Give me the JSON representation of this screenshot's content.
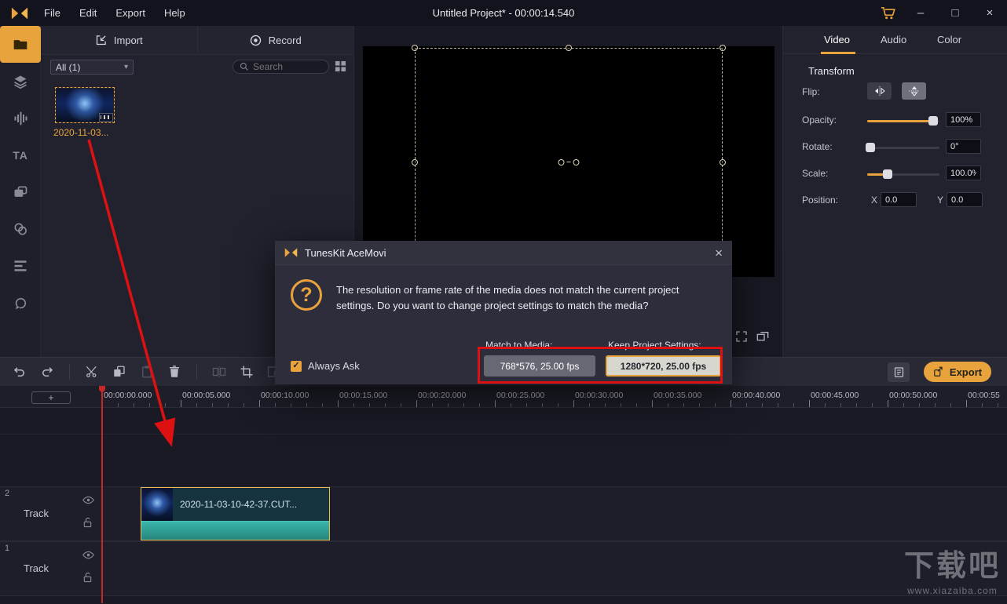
{
  "titlebar": {
    "menus": [
      "File",
      "Edit",
      "Export",
      "Help"
    ],
    "title": "Untitled Project* - 00:00:14.540"
  },
  "icons": {
    "plus": "+",
    "close": "×",
    "minimize": "–",
    "maximize": "□",
    "chevron_down": "▾",
    "check": "✓",
    "question": "?",
    "text_tool": "TA"
  },
  "media_panel": {
    "import_tab": "Import",
    "record_tab": "Record",
    "filter_value": "All (1)",
    "search_placeholder": "Search",
    "item_label": "2020-11-03..."
  },
  "inspector": {
    "tabs": [
      "Video",
      "Audio",
      "Color"
    ],
    "transform": {
      "heading": "Transform",
      "flip_label": "Flip:",
      "opacity_label": "Opacity:",
      "opacity_value": "100%",
      "rotate_label": "Rotate:",
      "rotate_value": "0°",
      "scale_label": "Scale:",
      "scale_value": "100.0%",
      "position_label": "Position:",
      "x_label": "X",
      "x_value": "0.0",
      "y_label": "Y",
      "y_value": "0.0"
    }
  },
  "toolbar": {
    "export_label": "Export"
  },
  "dialog": {
    "title": "TunesKit AceMovi",
    "message": "The resolution or frame rate of the media does not match the current project settings. Do you want to change project settings to match the media?",
    "always_ask_label": "Always Ask",
    "match_label": "Match to Media:",
    "keep_label": "Keep Project Settings:",
    "match_button": "768*576, 25.00 fps",
    "keep_button": "1280*720, 25.00 fps"
  },
  "timeline": {
    "ruler_labels": [
      "00:00:00.000",
      "00:00:05.000",
      "00:00:10.000",
      "00:00:15.000",
      "00:00:20.000",
      "00:00:25.000",
      "00:00:30.000",
      "00:00:35.000",
      "00:00:40.000",
      "00:00:45.000",
      "00:00:50.000",
      "00:00:55"
    ],
    "tracks": [
      {
        "number": "2",
        "label": "Track"
      },
      {
        "number": "1",
        "label": "Track"
      }
    ],
    "clip_label": "2020-11-03-10-42-37.CUT..."
  },
  "watermark": {
    "line1": "下载吧",
    "line2": "www.xiazaiba.com"
  },
  "colors": {
    "accent": "#e8a33d",
    "annotation_red": "#dd1111",
    "playhead_red": "#c62828"
  }
}
